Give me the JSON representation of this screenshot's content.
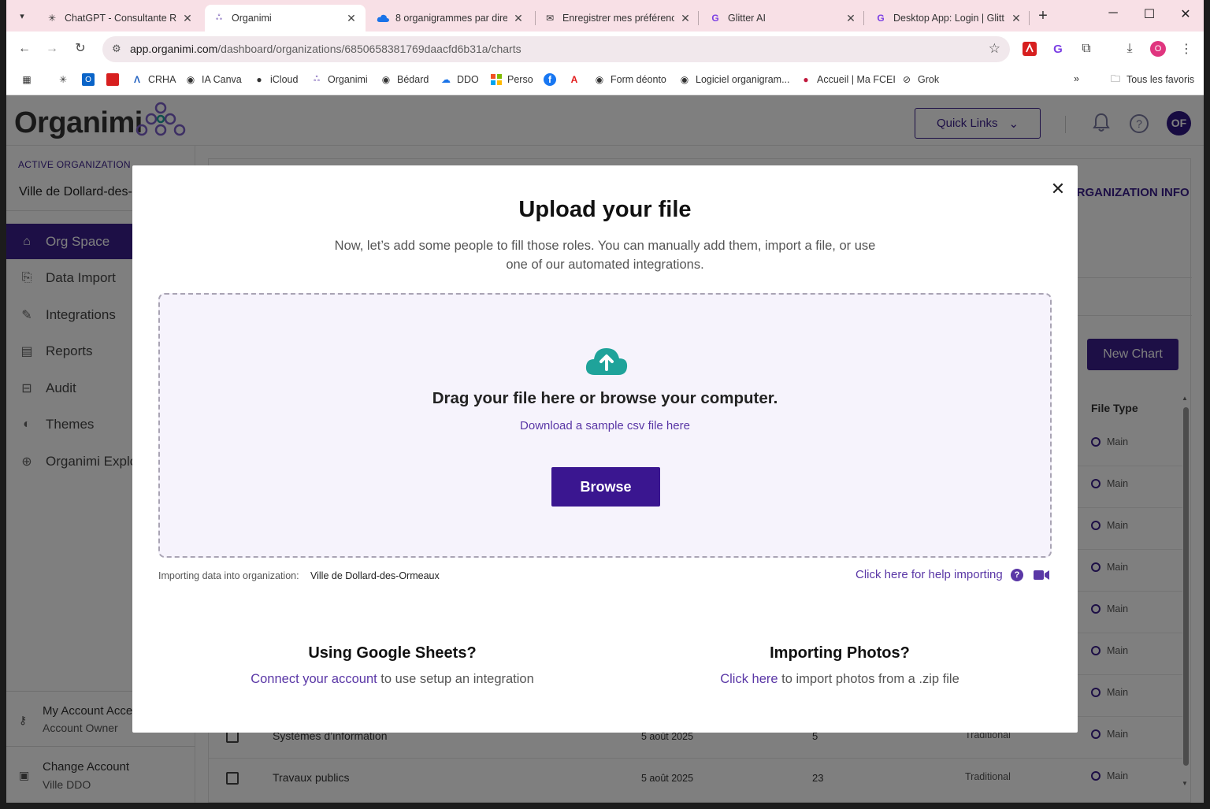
{
  "browser": {
    "tabs": [
      {
        "label": "ChatGPT - Consultante RH",
        "icon": "chatgpt-icon"
      },
      {
        "label": "Organimi",
        "icon": "organimi-icon"
      },
      {
        "label": "8 organigrammes par dire",
        "icon": "onedrive-icon"
      },
      {
        "label": "Enregistrer mes préférenc",
        "icon": "mail-icon"
      },
      {
        "label": "Glitter AI",
        "icon": "glitter-icon"
      },
      {
        "label": "Desktop App: Login | Glitt",
        "icon": "glitter-icon"
      }
    ],
    "url_host": "app.organimi.com",
    "url_path": "/dashboard/organizations/6850658381769daacfd6b31a/charts",
    "profile_initial": "O",
    "bookmarks": [
      {
        "label": "CRHA"
      },
      {
        "label": "IA Canva"
      },
      {
        "label": "iCloud"
      },
      {
        "label": "Organimi"
      },
      {
        "label": "Bédard"
      },
      {
        "label": "DDO"
      },
      {
        "label": "Perso"
      },
      {
        "label": "Form déonto"
      },
      {
        "label": "Logiciel organigram..."
      },
      {
        "label": "Accueil | Ma FCEI"
      },
      {
        "label": "Grok"
      }
    ],
    "all_bookmarks_label": "Tous les favoris"
  },
  "app": {
    "logo_text": "Organimi",
    "quick_links_label": "Quick Links",
    "user_initials": "OF",
    "active_org_label": "ACTIVE ORGANIZATION",
    "active_org_name": "Ville de Dollard-des-Ormeaux",
    "sidebar": [
      {
        "label": "Org Space",
        "active": true
      },
      {
        "label": "Data Import"
      },
      {
        "label": "Integrations"
      },
      {
        "label": "Reports"
      },
      {
        "label": "Audit"
      },
      {
        "label": "Themes"
      },
      {
        "label": "Organimi Explorer"
      }
    ],
    "account": {
      "title": "My Account Access",
      "subtitle": "Account Owner"
    },
    "change_account": {
      "title": "Change Account",
      "subtitle": "Ville DDO"
    },
    "org_info_tab": "ORGANIZATION INFO",
    "new_chart_label": "New Chart",
    "file_type_header": "File Type",
    "file_type_value": "Main",
    "rows": [
      {
        "name": "Systèmes d’information",
        "date": "5 août 2025",
        "count": "5",
        "type": "Traditional",
        "file_type": "Main"
      },
      {
        "name": "Travaux publics",
        "date": "5 août 2025",
        "count": "23",
        "type": "Traditional",
        "file_type": "Main"
      }
    ]
  },
  "modal": {
    "title": "Upload your file",
    "description": "Now, let’s add some people to fill those roles. You can manually add them, import a file, or use one of our automated integrations.",
    "dropzone_title": "Drag your file here or browse your computer.",
    "sample_link": "Download a sample csv file here",
    "browse_label": "Browse",
    "importing_label": "Importing data into organization:",
    "importing_value": "Ville de Dollard-des-Ormeaux",
    "help_link": "Click here for help importing",
    "google_title": "Using Google Sheets?",
    "google_link": "Connect your account",
    "google_text": " to use setup an integration",
    "photos_title": "Importing Photos?",
    "photos_link": "Click here",
    "photos_text": " to import photos from a .zip file"
  },
  "colors": {
    "brand_purple": "#3a1f8c",
    "link_purple": "#5a37a6",
    "cloud_teal": "#1fa39a",
    "tab_strip": "#f8e0e6"
  }
}
